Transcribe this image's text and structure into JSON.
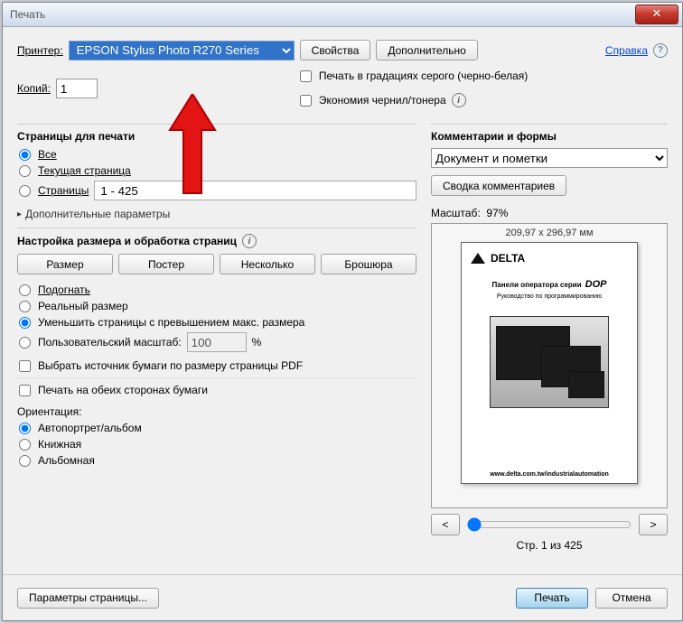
{
  "window": {
    "title": "Печать"
  },
  "top": {
    "printer_label": "Принтер:",
    "printer_value": "EPSON Stylus Photo R270 Series",
    "properties": "Свойства",
    "advanced": "Дополнительно",
    "help_link": "Справка",
    "copies_label": "Копий:",
    "copies_value": "1",
    "grayscale": "Печать в градациях серого (черно-белая)",
    "ink_save": "Экономия чернил/тонера"
  },
  "pages": {
    "title": "Страницы для печати",
    "all": "Все",
    "current": "Текущая страница",
    "range_label": "Страницы",
    "range_value": "1 - 425",
    "more": "Дополнительные параметры"
  },
  "sizing": {
    "title": "Настройка размера и обработка страниц",
    "btn_size": "Размер",
    "btn_poster": "Постер",
    "btn_multiple": "Несколько",
    "btn_booklet": "Брошюра",
    "fit": "Подогнать",
    "actual": "Реальный размер",
    "shrink": "Уменьшить страницы с превышением макс. размера",
    "custom": "Пользовательский масштаб:",
    "custom_value": "100",
    "percent": "%",
    "source_by_pdf": "Выбрать источник бумаги по размеру страницы PDF",
    "duplex": "Печать на обеих сторонах бумаги"
  },
  "orientation": {
    "title": "Ориентация:",
    "auto": "Автопортрет/альбом",
    "portrait": "Книжная",
    "landscape": "Альбомная"
  },
  "comments": {
    "title": "Комментарии и формы",
    "combo_value": "Документ и пометки",
    "summary_btn": "Сводка комментариев"
  },
  "preview": {
    "scale_label": "Масштаб:",
    "scale_value": "97%",
    "paper_dims": "209,97 x 296,97 мм",
    "doc_logo": "DELTA",
    "doc_title_prefix": "Панели оператора серии",
    "doc_title_brand": "DOP",
    "doc_subtitle": "Руководство по программированию",
    "doc_url": "www.delta.com.tw/industrialautomation",
    "page_counter": "Стр. 1 из 425"
  },
  "footer": {
    "page_setup": "Параметры страницы...",
    "print": "Печать",
    "cancel": "Отмена"
  }
}
